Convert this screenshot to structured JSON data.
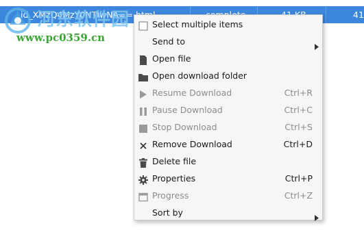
{
  "download_row": {
    "filename": "id_XMzQ4MzY0NTIwNA==.html",
    "status": "complete",
    "size": "41 KB",
    "extra": "41"
  },
  "watermark": {
    "title": "河东软件园",
    "url": "www.pc0359.cn"
  },
  "context_menu": {
    "items": [
      {
        "label": "Select multiple items",
        "shortcut": "",
        "icon": "checkbox-icon",
        "enabled": true,
        "submenu": false
      },
      {
        "label": "Send to",
        "shortcut": "",
        "icon": "",
        "enabled": true,
        "submenu": true
      },
      {
        "label": "Open file",
        "shortcut": "",
        "icon": "file-icon",
        "enabled": true,
        "submenu": false
      },
      {
        "label": "Open download folder",
        "shortcut": "",
        "icon": "folder-icon",
        "enabled": true,
        "submenu": false
      },
      {
        "label": "Resume Download",
        "shortcut": "Ctrl+R",
        "icon": "play-icon",
        "enabled": false,
        "submenu": false
      },
      {
        "label": "Pause Download",
        "shortcut": "Ctrl+C",
        "icon": "pause-icon",
        "enabled": false,
        "submenu": false
      },
      {
        "label": "Stop Download",
        "shortcut": "Ctrl+S",
        "icon": "stop-icon",
        "enabled": false,
        "submenu": false
      },
      {
        "label": "Remove Download",
        "shortcut": "Ctrl+D",
        "icon": "close-icon",
        "enabled": true,
        "submenu": false
      },
      {
        "label": "Delete file",
        "shortcut": "",
        "icon": "trash-icon",
        "enabled": true,
        "submenu": false
      },
      {
        "label": "Properties",
        "shortcut": "Ctrl+P",
        "icon": "gear-icon",
        "enabled": true,
        "submenu": false
      },
      {
        "label": "Progress",
        "shortcut": "Ctrl+Z",
        "icon": "window-icon",
        "enabled": false,
        "submenu": false
      },
      {
        "label": "Sort by",
        "shortcut": "",
        "icon": "",
        "enabled": true,
        "submenu": true
      }
    ]
  },
  "colors": {
    "selection": "#3d86dd",
    "menu_bg": "#f6f6f6",
    "disabled_text": "#8c8c8c",
    "icon_dark": "#4a4a4a",
    "icon_disabled": "#9a9a9a"
  }
}
